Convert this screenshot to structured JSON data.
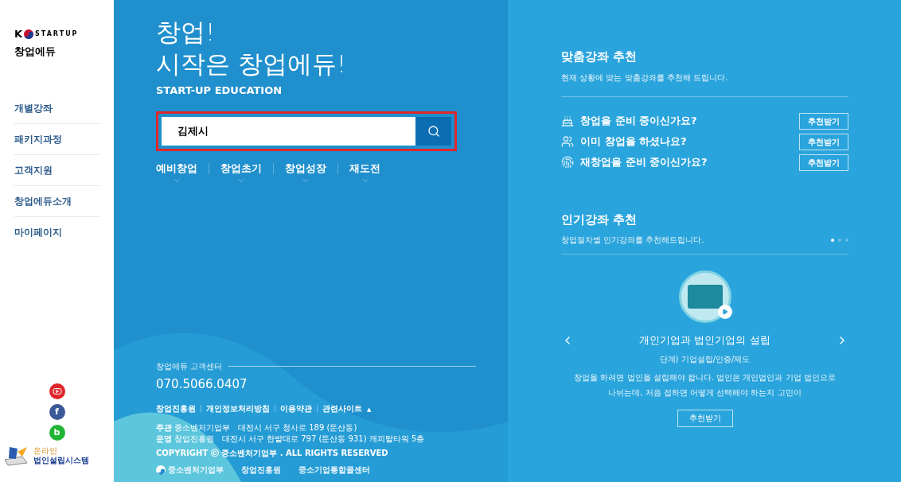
{
  "sidebar": {
    "logo": {
      "letter": "K",
      "word": "STARTUP",
      "subtitle": "창업에듀"
    },
    "menu": [
      {
        "label": "개별강좌"
      },
      {
        "label": "패키지과정"
      },
      {
        "label": "고객지원"
      },
      {
        "label": "창업에듀소개"
      },
      {
        "label": "마이페이지"
      }
    ],
    "social": [
      {
        "kind": "youtube"
      },
      {
        "kind": "facebook",
        "label": "f"
      },
      {
        "kind": "band",
        "label": "b"
      }
    ],
    "system_link": {
      "top": "온라인",
      "bottom": "법인설립시스템"
    }
  },
  "hero": {
    "title_lines": [
      "창업!",
      "시작은 창업에듀!"
    ],
    "subtitle": "START-UP EDUCATION",
    "search": {
      "value": "김제시",
      "highlighted": true
    },
    "categories": [
      {
        "label": "예비창업"
      },
      {
        "label": "창업초기"
      },
      {
        "label": "창업성장"
      },
      {
        "label": "재도전"
      }
    ]
  },
  "footer": {
    "center_label": "창업에듀 고객센터",
    "phone": "070.5066.0407",
    "links": [
      {
        "label": "창업진흥원"
      },
      {
        "label": "개인정보처리방침"
      },
      {
        "label": "이용약관"
      },
      {
        "label": "관련사이트",
        "toggle": "▲"
      }
    ],
    "address_lines": [
      {
        "role": "주관",
        "text": "중소벤처기업부   대전시 서구 청사로 189 (둔산동)"
      },
      {
        "role": "운영",
        "text": "창업진흥원   대전시 서구 한밭대로 797 (둔산동 931) 캐피탈타워 5층"
      }
    ],
    "copyright": "COPYRIGHT ⓒ 중소벤처기업부 . ALL RIGHTS RESERVED",
    "partners": [
      {
        "name": "중소벤처기업부"
      },
      {
        "name": "창업진흥원"
      },
      {
        "name": "중소기업통합콜센터"
      }
    ]
  },
  "custom_courses": {
    "title": "맞춤강좌 추천",
    "description": "현재 상황에 맞는 맞춤강좌를 추천해 드립니다.",
    "items": [
      {
        "kind": "prepare",
        "question": "창업을 준비 중이신가요?",
        "button": "추천받기"
      },
      {
        "kind": "started",
        "question": "이미 창업을 하셨나요?",
        "button": "추천받기"
      },
      {
        "kind": "restart",
        "question": "재창업을 준비 중이신가요?",
        "button": "추천받기"
      }
    ]
  },
  "popular_courses": {
    "title": "인기강좌 추천",
    "description": "창업절차별 인기강좌를 추천해드립니다.",
    "pager": [
      {
        "selected": true
      },
      {
        "selected": false
      },
      {
        "selected": false
      }
    ],
    "slide": {
      "title": "개인기업과 법인기업의 설립",
      "stage": "단계) 기업설립/인증/제도",
      "summary": "창업을 하려면 법인을 설립해야 합니다. 법인은 개인법인과 기업 법인으로 나뉘는데, 처음 접하면 어떻게 선택해야 하는지 고민이",
      "button": "추천받기"
    }
  }
}
